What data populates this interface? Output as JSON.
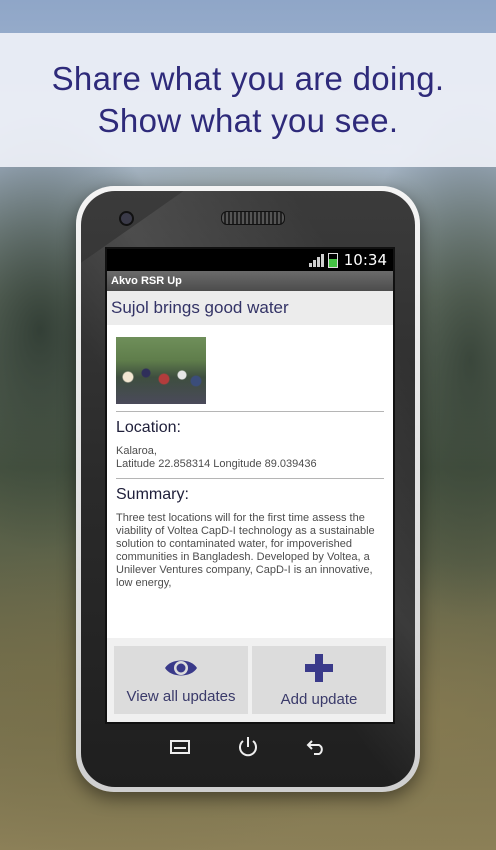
{
  "banner": {
    "line1": "Share what you are doing.",
    "line2": "Show what you see."
  },
  "status_bar": {
    "time": "10:34",
    "icons": [
      "signal-icon",
      "battery-icon"
    ]
  },
  "app": {
    "title": "Akvo RSR Up"
  },
  "project": {
    "title": "Sujol brings good water",
    "location_heading": "Location:",
    "location_line1": "Kalaroa,",
    "location_line2": "Latitude 22.858314 Longitude 89.039436",
    "summary_heading": "Summary:",
    "summary_text": "Three test locations will for the first time assess the viability of Voltea CapD-I technology as a sustainable solution to contaminated water, for impoverished communities in Bangladesh. Developed by Voltea, a Unilever Ventures company, CapD-I is an innovative, low energy,"
  },
  "actions": {
    "view_updates_label": "View all updates",
    "view_updates_icon": "eye-icon",
    "add_update_label": "Add update",
    "add_update_icon": "plus-icon"
  },
  "colors": {
    "accent": "#3a3a8a",
    "banner_text": "#2e2a7a"
  }
}
